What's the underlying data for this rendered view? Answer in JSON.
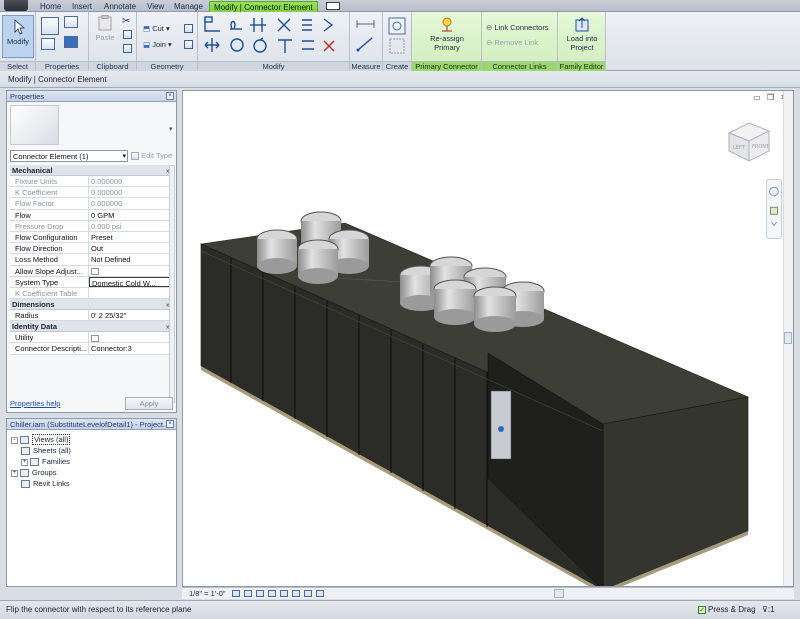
{
  "tabs": [
    "Home",
    "Insert",
    "Annotate",
    "View",
    "Manage",
    "Modify | Connector Element"
  ],
  "ribbon": {
    "select": {
      "modify": "Modify",
      "panel": "Select"
    },
    "properties": {
      "panel": "Properties"
    },
    "clipboard": {
      "paste": "Paste",
      "panel": "Clipboard"
    },
    "geometry": {
      "cut": "Cut",
      "join": "Join",
      "panel": "Geometry"
    },
    "modify": {
      "panel": "Modify"
    },
    "measure": {
      "panel": "Measure"
    },
    "create": {
      "panel": "Create"
    },
    "primary_connector": {
      "reassign": "Re-assign Primary",
      "panel": "Primary Connector"
    },
    "connector_links": {
      "link": "Link Connectors",
      "remove": "Remove Link",
      "panel": "Connector Links"
    },
    "family_editor": {
      "load": "Load into Project",
      "panel": "Family Editor"
    }
  },
  "context_bar": "Modify | Connector Element",
  "properties": {
    "title": "Properties",
    "type_selector": "Connector Element (1)",
    "edit_type": "Edit Type",
    "groups": [
      {
        "name": "Mechanical",
        "rows": [
          {
            "k": "Fixture Units",
            "v": "0.000000",
            "ro": true
          },
          {
            "k": "K Coefficient",
            "v": "0.000000",
            "ro": true
          },
          {
            "k": "Flow Factor",
            "v": "0.000000",
            "ro": true
          },
          {
            "k": "Flow",
            "v": "0 GPM",
            "ro": false
          },
          {
            "k": "Pressure Drop",
            "v": "0.000 psi",
            "ro": true
          },
          {
            "k": "Flow Configuration",
            "v": "Preset",
            "ro": false
          },
          {
            "k": "Flow Direction",
            "v": "Out",
            "ro": false
          },
          {
            "k": "Loss Method",
            "v": "Not Defined",
            "ro": false
          },
          {
            "k": "Allow Slope Adjust...",
            "v": "",
            "ro": false,
            "check": true
          },
          {
            "k": "System Type",
            "v": "Domestic Cold W...",
            "ro": false,
            "boxed": true
          },
          {
            "k": "K Coefficient Table",
            "v": "",
            "ro": true
          }
        ]
      },
      {
        "name": "Dimensions",
        "rows": [
          {
            "k": "Radius",
            "v": "0'  2 25/32\"",
            "ro": false
          }
        ]
      },
      {
        "name": "Identity Data",
        "rows": [
          {
            "k": "Utility",
            "v": "",
            "ro": false,
            "check": true
          },
          {
            "k": "Connector Descripti...",
            "v": "Connector:3",
            "ro": false
          }
        ]
      }
    ],
    "help": "Properties help",
    "apply": "Apply"
  },
  "browser": {
    "title": "Chiller.iam (SubstituteLevelofDetail1) - Project...",
    "items": [
      {
        "label": "Views (all)",
        "expander": "-",
        "indent": 0
      },
      {
        "label": "Sheets (all)",
        "expander": "",
        "indent": 1
      },
      {
        "label": "Families",
        "expander": "+",
        "indent": 1
      },
      {
        "label": "Groups",
        "expander": "+",
        "indent": 0
      },
      {
        "label": "Revit Links",
        "expander": "",
        "indent": 1
      }
    ]
  },
  "viewport": {
    "viewcube_left": "LEFT",
    "viewcube_front": "FRONT"
  },
  "viewbar": {
    "scale": "1/8\" = 1'-0\""
  },
  "status": {
    "text": "Flip the connector with respect to its reference plane",
    "press_drag": "Press & Drag",
    "filter": ":1"
  },
  "colors": {
    "accent_tab": "#7fd04a",
    "chiller_body": "#2f3128",
    "fan": "#c9c9c9"
  }
}
